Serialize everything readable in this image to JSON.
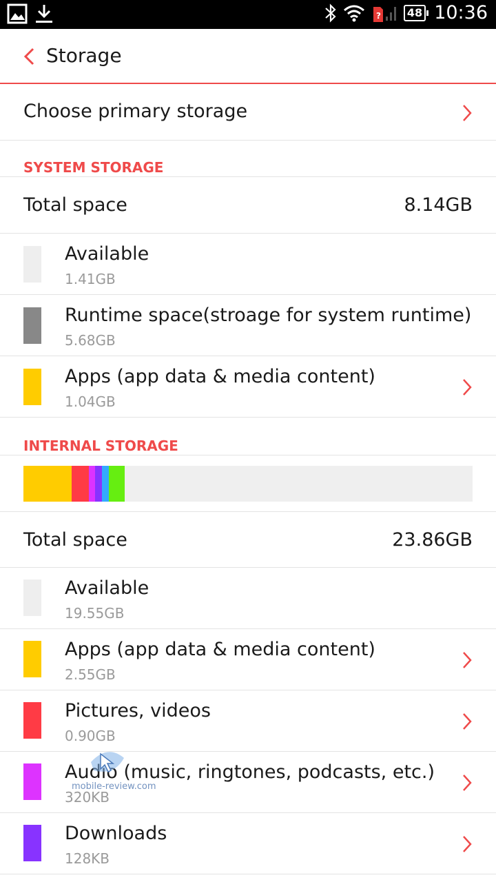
{
  "status_bar": {
    "time": "10:36",
    "battery": "48",
    "icons": [
      "gallery-icon",
      "download-icon",
      "bluetooth-icon",
      "wifi-icon",
      "no-sim-icon",
      "signal-icon",
      "battery-icon"
    ]
  },
  "header": {
    "title": "Storage",
    "back_icon": "chevron-left-icon"
  },
  "primary_storage": {
    "label": "Choose primary storage"
  },
  "system_storage": {
    "heading": "SYSTEM STORAGE",
    "total_label": "Total space",
    "total_value": "8.14GB",
    "items": [
      {
        "title": "Available",
        "size": "1.41GB",
        "color": "#eeeeee",
        "has_chevron": false
      },
      {
        "title": "Runtime space(stroage for system runtime)",
        "size": "5.68GB",
        "color": "#888888",
        "has_chevron": false
      },
      {
        "title": "Apps (app data & media content)",
        "size": "1.04GB",
        "color": "#ffcc00",
        "has_chevron": true
      }
    ]
  },
  "internal_storage": {
    "heading": "INTERNAL STORAGE",
    "usage_bar": [
      {
        "name": "apps",
        "color": "#ffcc00",
        "fraction": 0.107
      },
      {
        "name": "pictures",
        "color": "#ff3b45",
        "fraction": 0.038
      },
      {
        "name": "audio",
        "color": "#dd33ff",
        "fraction": 0.015
      },
      {
        "name": "downloads",
        "color": "#8833ff",
        "fraction": 0.015
      },
      {
        "name": "misc",
        "color": "#33aaff",
        "fraction": 0.015
      },
      {
        "name": "other",
        "color": "#66ee11",
        "fraction": 0.035
      }
    ],
    "total_label": "Total space",
    "total_value": "23.86GB",
    "items": [
      {
        "title": "Available",
        "size": "19.55GB",
        "color": "#eeeeee",
        "has_chevron": false
      },
      {
        "title": "Apps (app data & media content)",
        "size": "2.55GB",
        "color": "#ffcc00",
        "has_chevron": true
      },
      {
        "title": "Pictures, videos",
        "size": "0.90GB",
        "color": "#ff3b45",
        "has_chevron": true
      },
      {
        "title": "Audio (music, ringtones, podcasts, etc.)",
        "size": "320KB",
        "color": "#dd33ff",
        "has_chevron": true
      },
      {
        "title": "Downloads",
        "size": "128KB",
        "color": "#8833ff",
        "has_chevron": true
      }
    ]
  },
  "watermark": "mobile-review.com",
  "colors": {
    "accent": "#ef4a4a"
  }
}
